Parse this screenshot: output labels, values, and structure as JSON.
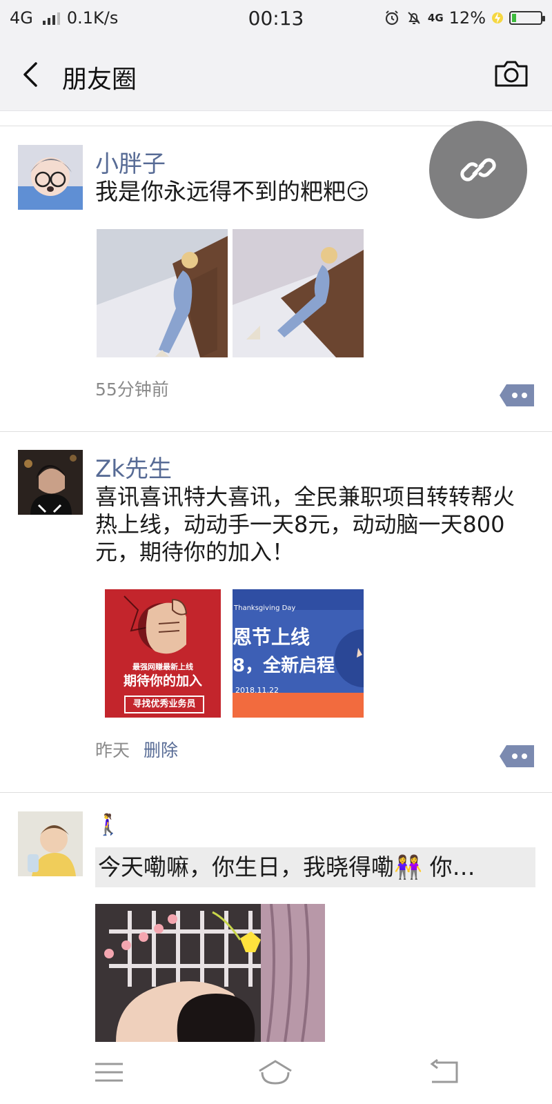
{
  "status_bar": {
    "network": "4G",
    "speed": "0.1K/s",
    "time": "00:13",
    "net2": "4G",
    "battery": "12%"
  },
  "header": {
    "title": "朋友圈"
  },
  "posts": [
    {
      "name": "小胖子",
      "text": "我是你永远得不到的粑粑😏",
      "time": "55分钟前"
    },
    {
      "name": "Zk先生",
      "text": "喜讯喜讯特大喜讯，全民兼职项目转转帮火热上线，动动手一天8元，动动脑一天800元，期待你的加入！",
      "time": "昨天",
      "delete_label": "删除",
      "images": [
        {
          "line1": "最强网赚最新上线",
          "line2": "期待你的加入",
          "line3": "寻找优秀业务员"
        },
        {
          "line1": "Thanksgiving Day",
          "line2": "恩节上线",
          "line3": "8，全新启程",
          "line4": "2018.11.22"
        }
      ]
    },
    {
      "name": "🚶‍♀️",
      "text": "今天嘞嘛，你生日，我晓得嘞👭 你…"
    }
  ],
  "colors": {
    "nickname": "#576b95",
    "bar_bg": "#f2f2f4",
    "fab": "#7f7f80"
  }
}
